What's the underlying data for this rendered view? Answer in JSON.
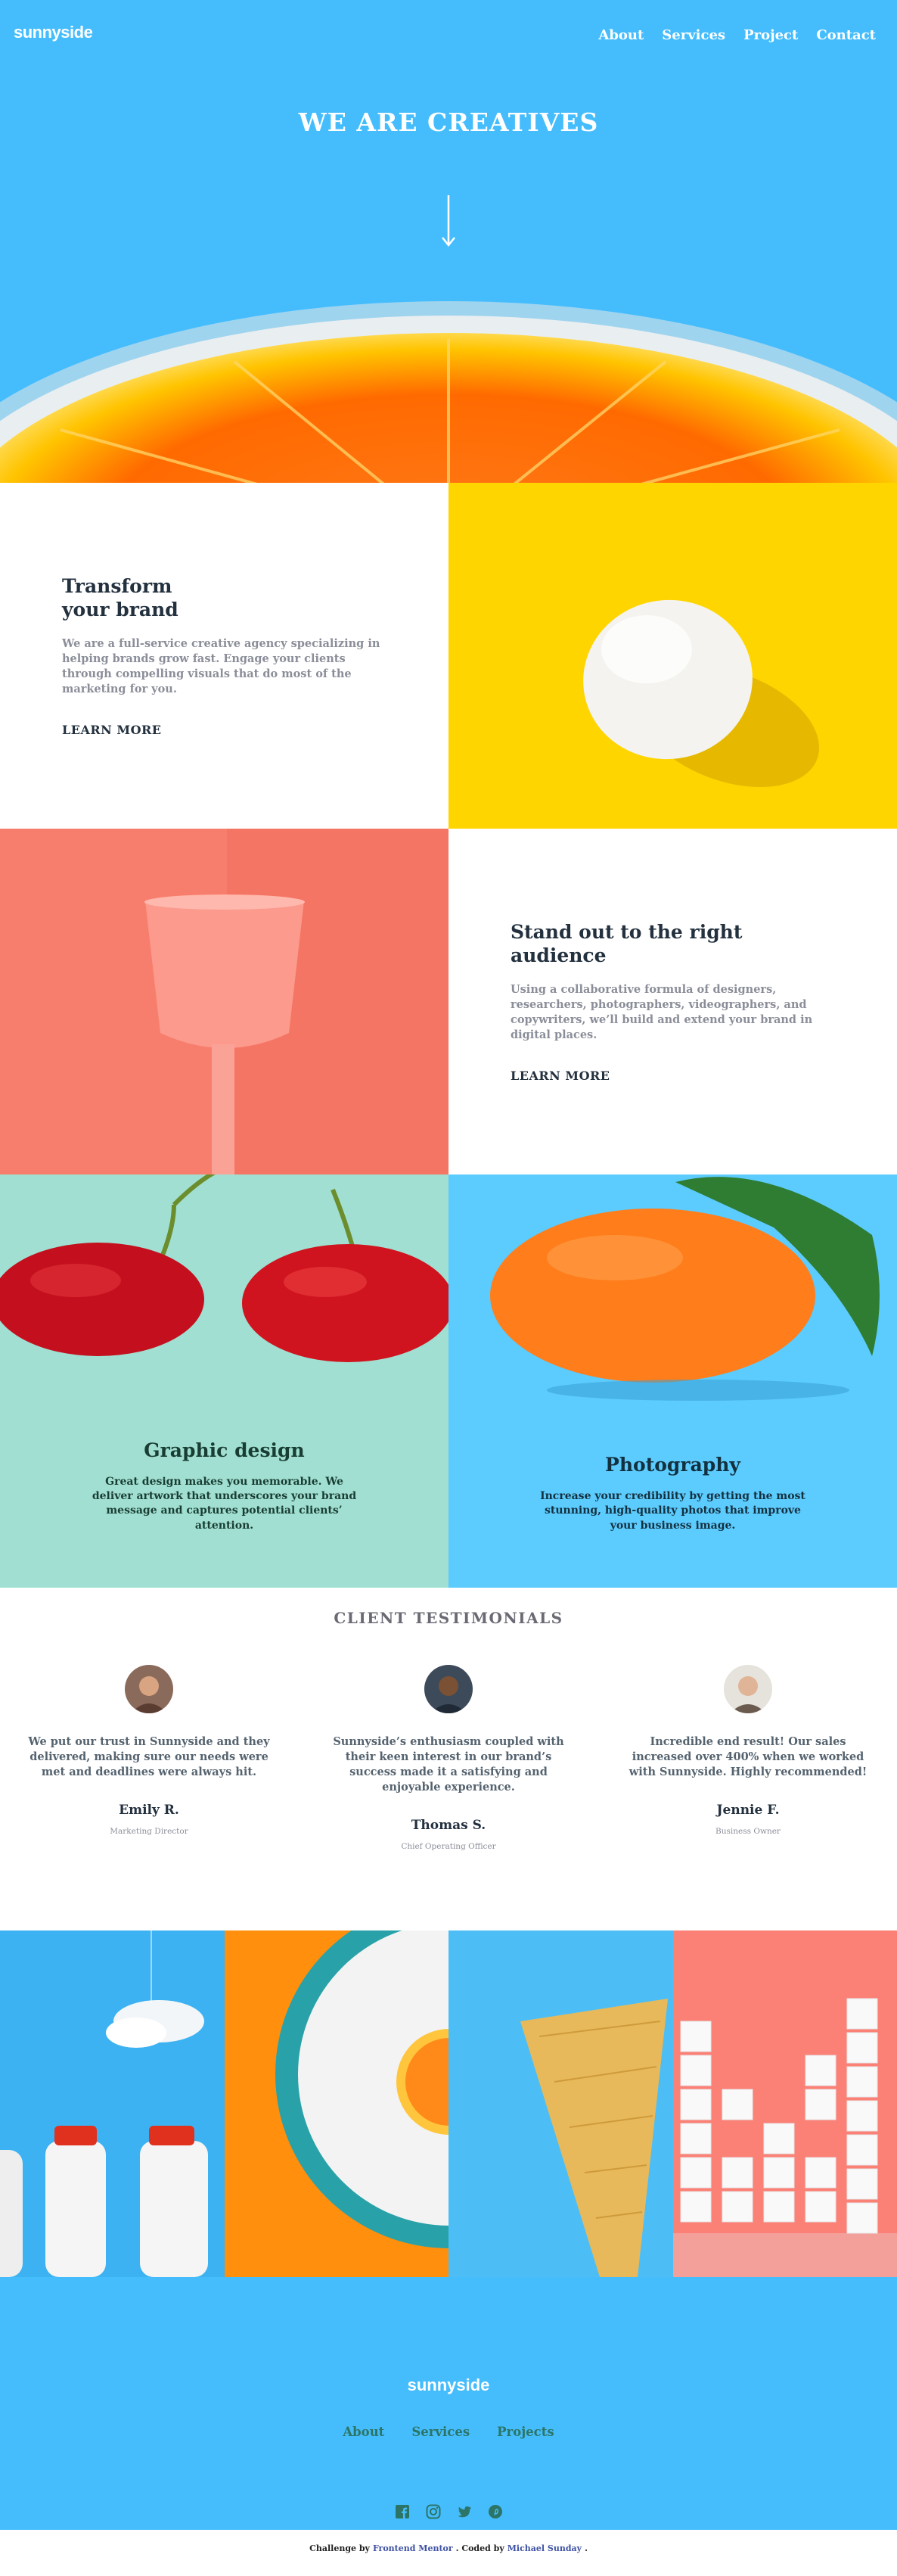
{
  "header": {
    "logo": "sunnyside",
    "nav": [
      "About",
      "Services",
      "Project",
      "Contact"
    ]
  },
  "hero": {
    "title": "WE ARE CREATIVES"
  },
  "feature1": {
    "title": "Transform your brand",
    "body": "We are a full-service creative agency specializing in helping brands grow fast. Engage your clients through compelling visuals that do most of the marketing for you.",
    "link": "LEARN MORE"
  },
  "feature2": {
    "title": "Stand out to the right audience",
    "body": "Using a collaborative formula of designers, researchers, photographers, videographers, and copywriters, we’ll build and extend your brand in digital places.",
    "link": "LEARN MORE"
  },
  "services": [
    {
      "title": "Graphic design",
      "body": "Great design makes you memorable. We deliver artwork that underscores your brand message and captures potential clients’ attention."
    },
    {
      "title": "Photography",
      "body": "Increase your credibility by getting the most stunning, high-quality photos that improve your business image."
    }
  ],
  "testimonials": {
    "heading": "CLIENT TESTIMONIALS",
    "items": [
      {
        "quote": "We put our trust in Sunnyside and they delivered, making sure our needs were met and deadlines were always hit.",
        "name": "Emily R.",
        "role": "Marketing Director"
      },
      {
        "quote": "Sunnyside’s enthusiasm coupled with their keen interest in our brand’s success made it a satisfying and enjoyable experience.",
        "name": "Thomas S.",
        "role": "Chief Operating Officer"
      },
      {
        "quote": "Incredible end result! Our sales increased over 400% when we worked with Sunnyside. Highly recommended!",
        "name": "Jennie F.",
        "role": "Business Owner"
      }
    ]
  },
  "footer": {
    "logo": "sunnyside",
    "nav": [
      "About",
      "Services",
      "Projects"
    ],
    "socials": [
      "facebook-icon",
      "instagram-icon",
      "twitter-icon",
      "pinterest-icon"
    ]
  },
  "attribution": {
    "prefix": "Challenge by",
    "fm": "Frontend Mentor",
    "mid": ". Coded by",
    "author": "Michael Sunday",
    "suffix": "."
  },
  "colors": {
    "hero_blue": "#45bdfd",
    "yellow": "#ffd500",
    "coral": "#f77e6c",
    "mint": "#a0dfd1",
    "sky": "#5ccbfd",
    "dark_text": "#23303e",
    "grey_text": "#8b8e99"
  }
}
